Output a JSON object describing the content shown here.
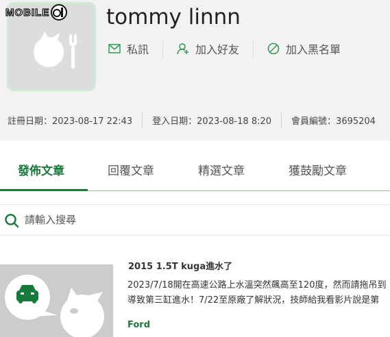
{
  "logo": {
    "text": "MOBILE"
  },
  "profile": {
    "username": "tommy linnn",
    "actions": [
      {
        "label": "私訊",
        "icon": "mail-icon"
      },
      {
        "label": "加入好友",
        "icon": "add-friend-icon"
      },
      {
        "label": "加入黑名單",
        "icon": "block-icon"
      }
    ],
    "register_date": "註冊日期：2023-08-17 22:43",
    "login_date": "登入日期：2023-08-18 8:20",
    "member_id": "會員編號：3695204"
  },
  "tabs": [
    {
      "label": "發佈文章",
      "active": true
    },
    {
      "label": "回覆文章",
      "active": false
    },
    {
      "label": "精選文章",
      "active": false
    },
    {
      "label": "獲鼓勵文章",
      "active": false
    }
  ],
  "search": {
    "placeholder": "請輸入搜尋",
    "value": ""
  },
  "posts": [
    {
      "title": "2015 1.5T kuga進水了",
      "excerpt_line1": "2023/7/18開在高速公路上水溫突然飆高至120度，然而請拖吊到",
      "excerpt_line2": "導致第三缸進水！7/22至原廠了解狀況，技師給我看影片說是第",
      "tag": "Ford"
    }
  ],
  "colors": {
    "accent": "#1a7a3b",
    "avatar_border": "#cfe9d6",
    "header_bg": "#f2f2f2"
  }
}
